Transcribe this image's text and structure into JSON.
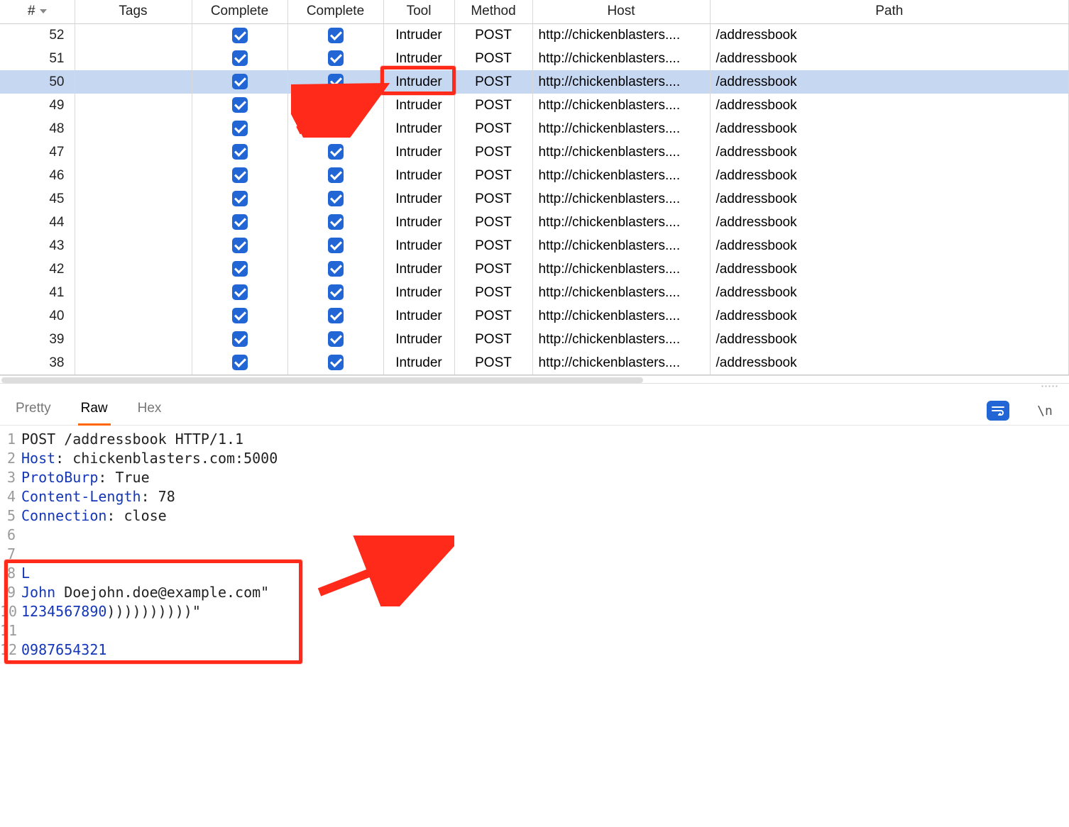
{
  "table": {
    "columns": [
      "#",
      "Tags",
      "Complete",
      "Complete",
      "Tool",
      "Method",
      "Host",
      "Path"
    ],
    "rows": [
      {
        "num": 52,
        "complete1": true,
        "complete2": true,
        "tool": "Intruder",
        "method": "POST",
        "host": "http://chickenblasters....",
        "path": "/addressbook",
        "selected": false
      },
      {
        "num": 51,
        "complete1": true,
        "complete2": true,
        "tool": "Intruder",
        "method": "POST",
        "host": "http://chickenblasters....",
        "path": "/addressbook",
        "selected": false
      },
      {
        "num": 50,
        "complete1": true,
        "complete2": true,
        "tool": "Intruder",
        "method": "POST",
        "host": "http://chickenblasters....",
        "path": "/addressbook",
        "selected": true
      },
      {
        "num": 49,
        "complete1": true,
        "complete2": true,
        "tool": "Intruder",
        "method": "POST",
        "host": "http://chickenblasters....",
        "path": "/addressbook",
        "selected": false
      },
      {
        "num": 48,
        "complete1": true,
        "complete2": true,
        "tool": "Intruder",
        "method": "POST",
        "host": "http://chickenblasters....",
        "path": "/addressbook",
        "selected": false
      },
      {
        "num": 47,
        "complete1": true,
        "complete2": true,
        "tool": "Intruder",
        "method": "POST",
        "host": "http://chickenblasters....",
        "path": "/addressbook",
        "selected": false
      },
      {
        "num": 46,
        "complete1": true,
        "complete2": true,
        "tool": "Intruder",
        "method": "POST",
        "host": "http://chickenblasters....",
        "path": "/addressbook",
        "selected": false
      },
      {
        "num": 45,
        "complete1": true,
        "complete2": true,
        "tool": "Intruder",
        "method": "POST",
        "host": "http://chickenblasters....",
        "path": "/addressbook",
        "selected": false
      },
      {
        "num": 44,
        "complete1": true,
        "complete2": true,
        "tool": "Intruder",
        "method": "POST",
        "host": "http://chickenblasters....",
        "path": "/addressbook",
        "selected": false
      },
      {
        "num": 43,
        "complete1": true,
        "complete2": true,
        "tool": "Intruder",
        "method": "POST",
        "host": "http://chickenblasters....",
        "path": "/addressbook",
        "selected": false
      },
      {
        "num": 42,
        "complete1": true,
        "complete2": true,
        "tool": "Intruder",
        "method": "POST",
        "host": "http://chickenblasters....",
        "path": "/addressbook",
        "selected": false
      },
      {
        "num": 41,
        "complete1": true,
        "complete2": true,
        "tool": "Intruder",
        "method": "POST",
        "host": "http://chickenblasters....",
        "path": "/addressbook",
        "selected": false
      },
      {
        "num": 40,
        "complete1": true,
        "complete2": true,
        "tool": "Intruder",
        "method": "POST",
        "host": "http://chickenblasters....",
        "path": "/addressbook",
        "selected": false
      },
      {
        "num": 39,
        "complete1": true,
        "complete2": true,
        "tool": "Intruder",
        "method": "POST",
        "host": "http://chickenblasters....",
        "path": "/addressbook",
        "selected": false
      },
      {
        "num": 38,
        "complete1": true,
        "complete2": true,
        "tool": "Intruder",
        "method": "POST",
        "host": "http://chickenblasters....",
        "path": "/addressbook",
        "selected": false
      }
    ]
  },
  "tabs": {
    "items": [
      "Pretty",
      "Raw",
      "Hex"
    ],
    "active": "Raw",
    "newline_label": "\\n"
  },
  "editor": {
    "lines": [
      [
        {
          "cls": "txt",
          "t": "POST /addressbook HTTP/1.1"
        }
      ],
      [
        {
          "cls": "kw",
          "t": "Host"
        },
        {
          "cls": "txt",
          "t": ": chickenblasters.com:5000"
        }
      ],
      [
        {
          "cls": "kw",
          "t": "ProtoBurp"
        },
        {
          "cls": "txt",
          "t": ": True"
        }
      ],
      [
        {
          "cls": "kw",
          "t": "Content-Length"
        },
        {
          "cls": "txt",
          "t": ": 78"
        }
      ],
      [
        {
          "cls": "kw",
          "t": "Connection"
        },
        {
          "cls": "txt",
          "t": ": close"
        }
      ],
      [],
      [],
      [
        {
          "cls": "kw",
          "t": "L"
        }
      ],
      [
        {
          "cls": "kw",
          "t": "John"
        },
        {
          "cls": "txt",
          "t": " Doejohn.doe@example.com\""
        }
      ],
      [
        {
          "cls": "kw",
          "t": "1234567890"
        },
        {
          "cls": "txt",
          "t": "))))))))))\""
        }
      ],
      [],
      [
        {
          "cls": "kw",
          "t": "0987654321"
        }
      ]
    ]
  }
}
